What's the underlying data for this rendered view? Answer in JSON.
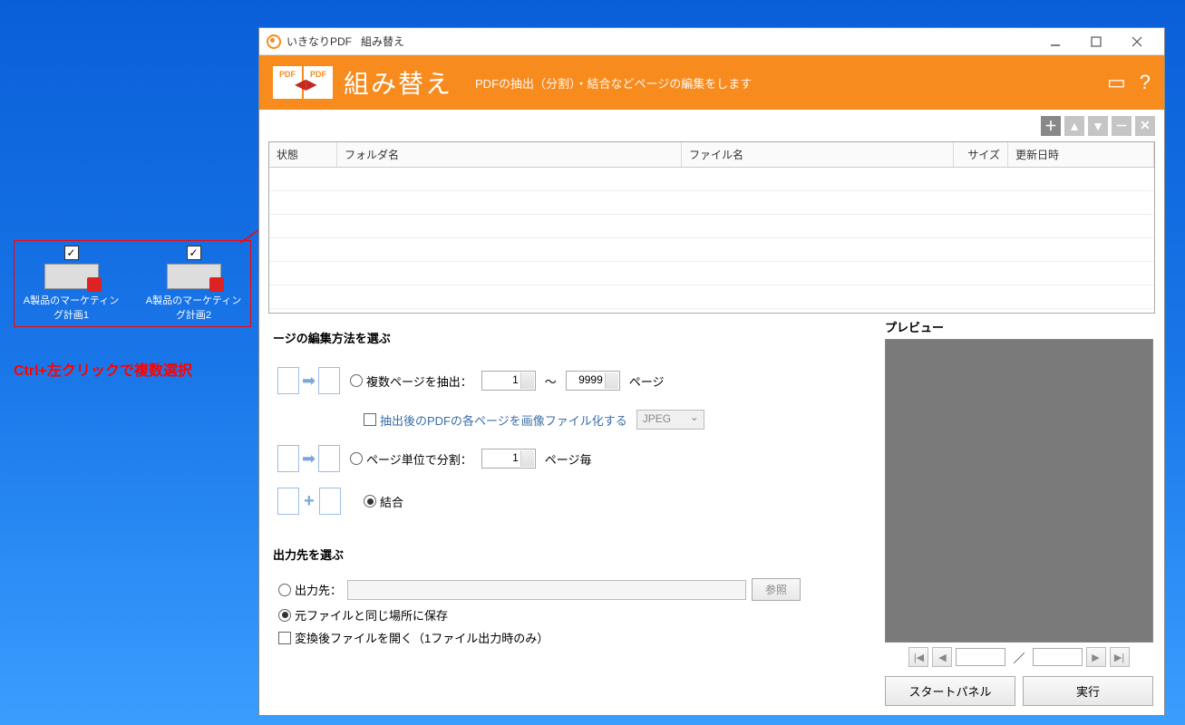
{
  "desktop": {
    "icons": [
      {
        "label": "A製品のマーケティング計画1"
      },
      {
        "label": "A製品のマーケティング計画2"
      }
    ],
    "annotation": "Ctrl+左クリックで複数選択"
  },
  "window": {
    "app_name": "いきなりPDF",
    "mode_name": "組み替え"
  },
  "header": {
    "icon_text": "PDF",
    "title": "組み替え",
    "subtitle": "PDFの抽出（分割）・結合などページの編集をします"
  },
  "table": {
    "columns": {
      "status": "状態",
      "folder": "フォルダ名",
      "file": "ファイル名",
      "size": "サイズ",
      "date": "更新日時"
    }
  },
  "edit": {
    "section_title": "ージの編集方法を選ぶ",
    "extract": {
      "label": "複数ページを抽出：",
      "from": "1",
      "to": "9999",
      "range_sep": "〜",
      "page_suffix": "ページ"
    },
    "imagize": {
      "label": "抽出後のPDFの各ページを画像ファイル化する",
      "format": "JPEG"
    },
    "split": {
      "label": "ページ単位で分割：",
      "value": "1",
      "suffix": "ページ毎"
    },
    "combine": {
      "label": "結合"
    }
  },
  "output": {
    "section_title": "出力先を選ぶ",
    "dest_label": "出力先：",
    "browse": "参照",
    "same_location": "元ファイルと同じ場所に保存",
    "open_after": "変換後ファイルを開く（1ファイル出力時のみ）"
  },
  "preview": {
    "label": "プレビュー",
    "separator": "／"
  },
  "actions": {
    "start_panel": "スタートパネル",
    "execute": "実行"
  }
}
